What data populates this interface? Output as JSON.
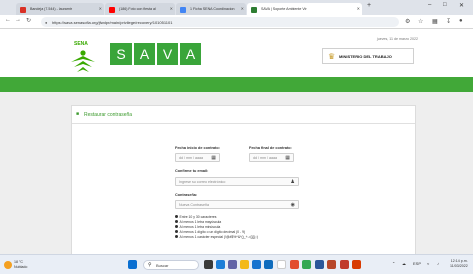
{
  "browser": {
    "tabs": [
      {
        "label": "Bandeja (7.544) - lauramtr",
        "fav_color": "#d93025",
        "active": false
      },
      {
        "label": "(186) Foto con fiesta al",
        "fav_color": "#ff0000",
        "active": false
      },
      {
        "label": "1 Ficha SENA Coordinacion",
        "fav_color": "#4285f4",
        "active": false
      },
      {
        "label": "SAVA | Soporte Ambiente Vir",
        "fav_color": "#2e7d32",
        "active": true
      }
    ],
    "new_tab": "+",
    "url": "https://sava.senasofia.org/jfwdpr/main/privilege/recovery/101051101",
    "lock_icon": "lock-icon",
    "window_controls": [
      "–",
      "□",
      "✕"
    ],
    "nav": {
      "back": "←",
      "forward": "→",
      "reload": "↻"
    }
  },
  "header": {
    "date": "jueves, 11 de marzo 2022",
    "sena_label": "SENA",
    "sava_letters": [
      "S",
      "A",
      "V",
      "A"
    ],
    "ministerio": "MINISTERIO DEL TRABAJO",
    "colors": {
      "green": "#41a838",
      "sava": "#3aa53a",
      "sena": "#39a900"
    }
  },
  "form": {
    "title": "Restaurar contraseña",
    "fecha_inicio_label": "Fecha inicio de contrato:",
    "fecha_inicio_value": "dd / mm / aaaa",
    "fecha_final_label": "Fecha final de contrato:",
    "fecha_final_value": "dd / mm / aaaa",
    "email_label": "Confirme tu email:",
    "email_placeholder": "Ingrese su correo electrónico",
    "password_label": "Contraseña:",
    "password_placeholder": "Nueva Contraseña",
    "rules": [
      "Entre 10 y 30 caracteres",
      "Al menos 1 letra mayúscula",
      "Al menos 1 letra minúscula",
      "Al menos 1 dígito o un dígito decimal (0 - 9)",
      "Al menos 1 carácter especial (!@#$%^&*()_+-=[]{};:)"
    ]
  },
  "taskbar": {
    "weather_temp": "18 °C",
    "weather_desc": "Nublado",
    "search_placeholder": "Buscar",
    "tray_lang": "ESP",
    "time": "12:14 p.m.",
    "date": "11/03/2022"
  }
}
